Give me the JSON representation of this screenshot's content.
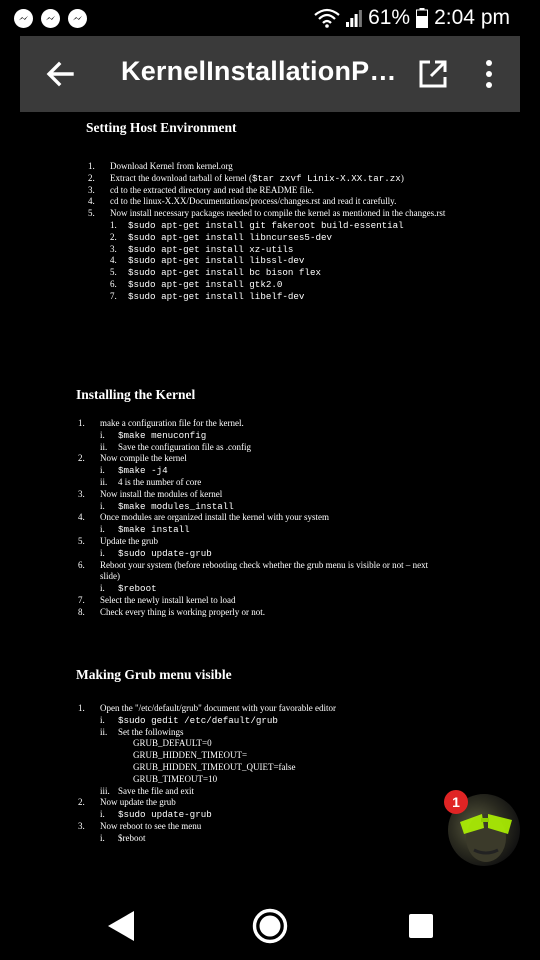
{
  "status_bar": {
    "battery": "61%",
    "time": "2:04 pm"
  },
  "app_bar": {
    "title": "KernelInstallationPr..."
  },
  "document": {
    "section1": {
      "heading": "Setting Host Environment",
      "items": [
        {
          "num": "1.",
          "text": "Download Kernel from kernel.org"
        },
        {
          "num": "2.",
          "text": "Extract the download tarball of kernel (",
          "code": "$tar zxvf Linix-X.XX.tar.zx",
          "after": ")"
        },
        {
          "num": "3.",
          "text": "cd to the extracted directory and read the README file."
        },
        {
          "num": "4.",
          "text": "cd to the linux-X.XX/Documentations/process/changes.rst and read it carefully."
        },
        {
          "num": "5.",
          "text": "Now install necessary packages needed to compile the kernel as mentioned in the changes.rst"
        }
      ],
      "sub_items": [
        {
          "num": "1.",
          "code": "$sudo apt-get install git fakeroot build-essential"
        },
        {
          "num": "2.",
          "code": "$sudo apt-get install libncurses5-dev"
        },
        {
          "num": "3.",
          "code": "$sudo apt-get install xz-utils"
        },
        {
          "num": "4.",
          "code": "$sudo apt-get install libssl-dev"
        },
        {
          "num": "5.",
          "code": "$sudo apt-get install bc bison flex"
        },
        {
          "num": "6.",
          "code": "$sudo apt-get install gtk2.0"
        },
        {
          "num": "7.",
          "code": "$sudo apt-get install libelf-dev"
        }
      ]
    },
    "section2": {
      "heading": "Installing the Kernel",
      "lines": [
        {
          "kind": "item",
          "num": "1.",
          "text": "make a configuration file for the kernel."
        },
        {
          "kind": "sub",
          "num": "i.",
          "code": "$make menuconfig"
        },
        {
          "kind": "sub",
          "num": "ii.",
          "text": "Save the configuration file as .config"
        },
        {
          "kind": "item",
          "num": "2.",
          "text": "Now compile the kernel"
        },
        {
          "kind": "sub",
          "num": "i.",
          "code": "$make -j4"
        },
        {
          "kind": "sub",
          "num": "ii.",
          "text": "4 is the number of core"
        },
        {
          "kind": "item",
          "num": "3.",
          "text": "Now install the modules of kernel"
        },
        {
          "kind": "sub",
          "num": "i.",
          "code": "$make modules_install"
        },
        {
          "kind": "item",
          "num": "4.",
          "text": "Once modules are organized install the kernel with your system"
        },
        {
          "kind": "sub",
          "num": "i.",
          "code": "$make install"
        },
        {
          "kind": "item",
          "num": "5.",
          "text": "Update the grub"
        },
        {
          "kind": "sub",
          "num": "i.",
          "code": "$sudo update-grub"
        },
        {
          "kind": "item",
          "num": "6.",
          "text": "Reboot your system (before rebooting check whether the grub menu is visible or not – next slide)"
        },
        {
          "kind": "sub",
          "num": "i.",
          "code": "$reboot"
        },
        {
          "kind": "item",
          "num": "7.",
          "text": "Select the newly install kernel to load"
        },
        {
          "kind": "item",
          "num": "8.",
          "text": "Check every thing is working properly or not."
        }
      ]
    },
    "section3": {
      "heading": "Making Grub menu visible",
      "lines": [
        {
          "kind": "item",
          "num": "1.",
          "text": "Open the \"/etc/default/grub\" document with your favorable editor"
        },
        {
          "kind": "sub",
          "num": "i.",
          "code": "$sudo gedit /etc/default/grub"
        },
        {
          "kind": "sub",
          "num": "ii.",
          "text": "Set the followings"
        },
        {
          "kind": "subsub",
          "text": "GRUB_DEFAULT=0"
        },
        {
          "kind": "subsub",
          "text": "GRUB_HIDDEN_TIMEOUT="
        },
        {
          "kind": "subsub",
          "text": "GRUB_HIDDEN_TIMEOUT_QUIET=false"
        },
        {
          "kind": "subsub",
          "text": "GRUB_TIMEOUT=10"
        },
        {
          "kind": "sub",
          "num": "iii.",
          "text": "Save the file and exit"
        },
        {
          "kind": "item",
          "num": "2.",
          "text": "Now update the grub"
        },
        {
          "kind": "sub",
          "num": "i.",
          "code": "$sudo update-grub"
        },
        {
          "kind": "item",
          "num": "3.",
          "text": "Now reboot to see the menu"
        },
        {
          "kind": "sub",
          "num": "i.",
          "text": "$reboot"
        }
      ]
    }
  },
  "chat_head": {
    "badge_count": "1"
  },
  "icons": {
    "status_left": [
      "messenger-icon",
      "messenger-icon",
      "messenger-icon"
    ],
    "status_right": [
      "wifi-icon",
      "signal-icon",
      "battery-icon"
    ],
    "app_bar": [
      "back-arrow-icon",
      "open-external-icon",
      "more-vert-icon"
    ],
    "nav_bar": [
      "back-triangle-icon",
      "home-circle-icon",
      "recents-square-icon"
    ]
  },
  "colors": {
    "app_bar_bg": "#3a3a3a",
    "badge": "#e02424"
  }
}
